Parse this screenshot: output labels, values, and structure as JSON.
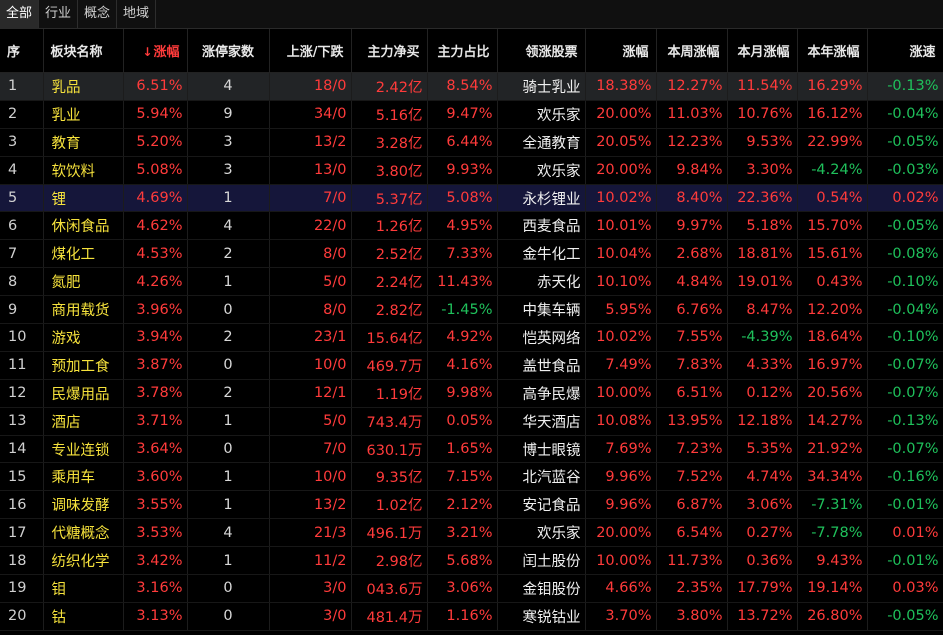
{
  "tabs": [
    "全部",
    "行业",
    "概念",
    "地域"
  ],
  "active_tab": 0,
  "sort_indicator": "↓",
  "columns": [
    "序",
    "板块名称",
    "涨幅",
    "涨停家数",
    "上涨/下跌",
    "主力净买",
    "主力占比",
    "领涨股票",
    "涨幅",
    "本周涨幅",
    "本月涨幅",
    "本年涨幅",
    "涨速"
  ],
  "rows": [
    {
      "idx": "1",
      "name": "乳品",
      "pct": "6.51%",
      "limit": "4",
      "updown": "18/0",
      "net": "2.42亿",
      "ratio": "8.54%",
      "leader": "骑士乳业",
      "lpct": "18.38%",
      "week": "12.27%",
      "month": "11.54%",
      "year": "16.29%",
      "speed": "-0.13%"
    },
    {
      "idx": "2",
      "name": "乳业",
      "pct": "5.94%",
      "limit": "9",
      "updown": "34/0",
      "net": "5.16亿",
      "ratio": "9.47%",
      "leader": "欢乐家",
      "lpct": "20.00%",
      "week": "11.03%",
      "month": "10.76%",
      "year": "16.12%",
      "speed": "-0.04%"
    },
    {
      "idx": "3",
      "name": "教育",
      "pct": "5.20%",
      "limit": "3",
      "updown": "13/2",
      "net": "3.28亿",
      "ratio": "6.44%",
      "leader": "全通教育",
      "lpct": "20.05%",
      "week": "12.23%",
      "month": "9.53%",
      "year": "22.99%",
      "speed": "-0.05%"
    },
    {
      "idx": "4",
      "name": "软饮料",
      "pct": "5.08%",
      "limit": "3",
      "updown": "13/0",
      "net": "3.80亿",
      "ratio": "9.93%",
      "leader": "欢乐家",
      "lpct": "20.00%",
      "week": "9.84%",
      "month": "3.30%",
      "year": "-4.24%",
      "speed": "-0.03%"
    },
    {
      "idx": "5",
      "name": "锂",
      "pct": "4.69%",
      "limit": "1",
      "updown": "7/0",
      "net": "5.37亿",
      "ratio": "5.08%",
      "leader": "永杉锂业",
      "lpct": "10.02%",
      "week": "8.40%",
      "month": "22.36%",
      "year": "0.54%",
      "speed": "0.02%"
    },
    {
      "idx": "6",
      "name": "休闲食品",
      "pct": "4.62%",
      "limit": "4",
      "updown": "22/0",
      "net": "1.26亿",
      "ratio": "4.95%",
      "leader": "西麦食品",
      "lpct": "10.01%",
      "week": "9.97%",
      "month": "5.18%",
      "year": "15.70%",
      "speed": "-0.05%"
    },
    {
      "idx": "7",
      "name": "煤化工",
      "pct": "4.53%",
      "limit": "2",
      "updown": "8/0",
      "net": "2.52亿",
      "ratio": "7.33%",
      "leader": "金牛化工",
      "lpct": "10.04%",
      "week": "2.68%",
      "month": "18.81%",
      "year": "15.61%",
      "speed": "-0.08%"
    },
    {
      "idx": "8",
      "name": "氮肥",
      "pct": "4.26%",
      "limit": "1",
      "updown": "5/0",
      "net": "2.24亿",
      "ratio": "11.43%",
      "leader": "赤天化",
      "lpct": "10.10%",
      "week": "4.84%",
      "month": "19.01%",
      "year": "0.43%",
      "speed": "-0.10%"
    },
    {
      "idx": "9",
      "name": "商用载货",
      "pct": "3.96%",
      "limit": "0",
      "updown": "8/0",
      "net": "2.82亿",
      "ratio": "-1.45%",
      "leader": "中集车辆",
      "lpct": "5.95%",
      "week": "6.76%",
      "month": "8.47%",
      "year": "12.20%",
      "speed": "-0.04%"
    },
    {
      "idx": "10",
      "name": "游戏",
      "pct": "3.94%",
      "limit": "2",
      "updown": "23/1",
      "net": "15.64亿",
      "ratio": "4.92%",
      "leader": "恺英网络",
      "lpct": "10.02%",
      "week": "7.55%",
      "month": "-4.39%",
      "year": "18.64%",
      "speed": "-0.10%"
    },
    {
      "idx": "11",
      "name": "预加工食",
      "pct": "3.87%",
      "limit": "0",
      "updown": "10/0",
      "net": "469.7万",
      "ratio": "4.16%",
      "leader": "盖世食品",
      "lpct": "7.49%",
      "week": "7.83%",
      "month": "4.33%",
      "year": "16.97%",
      "speed": "-0.07%"
    },
    {
      "idx": "12",
      "name": "民爆用品",
      "pct": "3.78%",
      "limit": "2",
      "updown": "12/1",
      "net": "1.19亿",
      "ratio": "9.98%",
      "leader": "高争民爆",
      "lpct": "10.00%",
      "week": "6.51%",
      "month": "0.12%",
      "year": "20.56%",
      "speed": "-0.07%"
    },
    {
      "idx": "13",
      "name": "酒店",
      "pct": "3.71%",
      "limit": "1",
      "updown": "5/0",
      "net": "743.4万",
      "ratio": "0.05%",
      "leader": "华天酒店",
      "lpct": "10.08%",
      "week": "13.95%",
      "month": "12.18%",
      "year": "14.27%",
      "speed": "-0.13%"
    },
    {
      "idx": "14",
      "name": "专业连锁",
      "pct": "3.64%",
      "limit": "0",
      "updown": "7/0",
      "net": "630.1万",
      "ratio": "1.65%",
      "leader": "博士眼镜",
      "lpct": "7.69%",
      "week": "7.23%",
      "month": "5.35%",
      "year": "21.92%",
      "speed": "-0.07%"
    },
    {
      "idx": "15",
      "name": "乘用车",
      "pct": "3.60%",
      "limit": "1",
      "updown": "10/0",
      "net": "9.35亿",
      "ratio": "7.15%",
      "leader": "北汽蓝谷",
      "lpct": "9.96%",
      "week": "7.52%",
      "month": "4.74%",
      "year": "34.34%",
      "speed": "-0.16%"
    },
    {
      "idx": "16",
      "name": "调味发酵",
      "pct": "3.55%",
      "limit": "1",
      "updown": "13/2",
      "net": "1.02亿",
      "ratio": "2.12%",
      "leader": "安记食品",
      "lpct": "9.96%",
      "week": "6.87%",
      "month": "3.06%",
      "year": "-7.31%",
      "speed": "-0.01%"
    },
    {
      "idx": "17",
      "name": "代糖概念",
      "pct": "3.53%",
      "limit": "4",
      "updown": "21/3",
      "net": "496.1万",
      "ratio": "3.21%",
      "leader": "欢乐家",
      "lpct": "20.00%",
      "week": "6.54%",
      "month": "0.27%",
      "year": "-7.78%",
      "speed": "0.01%"
    },
    {
      "idx": "18",
      "name": "纺织化学",
      "pct": "3.42%",
      "limit": "1",
      "updown": "11/2",
      "net": "2.98亿",
      "ratio": "5.68%",
      "leader": "闰土股份",
      "lpct": "10.00%",
      "week": "11.73%",
      "month": "0.36%",
      "year": "9.43%",
      "speed": "-0.01%"
    },
    {
      "idx": "19",
      "name": "钼",
      "pct": "3.16%",
      "limit": "0",
      "updown": "3/0",
      "net": "043.6万",
      "ratio": "3.06%",
      "leader": "金钼股份",
      "lpct": "4.66%",
      "week": "2.35%",
      "month": "17.79%",
      "year": "19.14%",
      "speed": "0.03%"
    },
    {
      "idx": "20",
      "name": "钴",
      "pct": "3.13%",
      "limit": "0",
      "updown": "3/0",
      "net": "481.4万",
      "ratio": "1.16%",
      "leader": "寒锐钴业",
      "lpct": "3.70%",
      "week": "3.80%",
      "month": "13.72%",
      "year": "26.80%",
      "speed": "-0.05%"
    }
  ],
  "colors": {
    "up": "#ff3b3b",
    "down": "#1fc05b",
    "name": "#f6e23c",
    "highlight_grey": "#222426",
    "highlight_blue": "#15163a"
  }
}
